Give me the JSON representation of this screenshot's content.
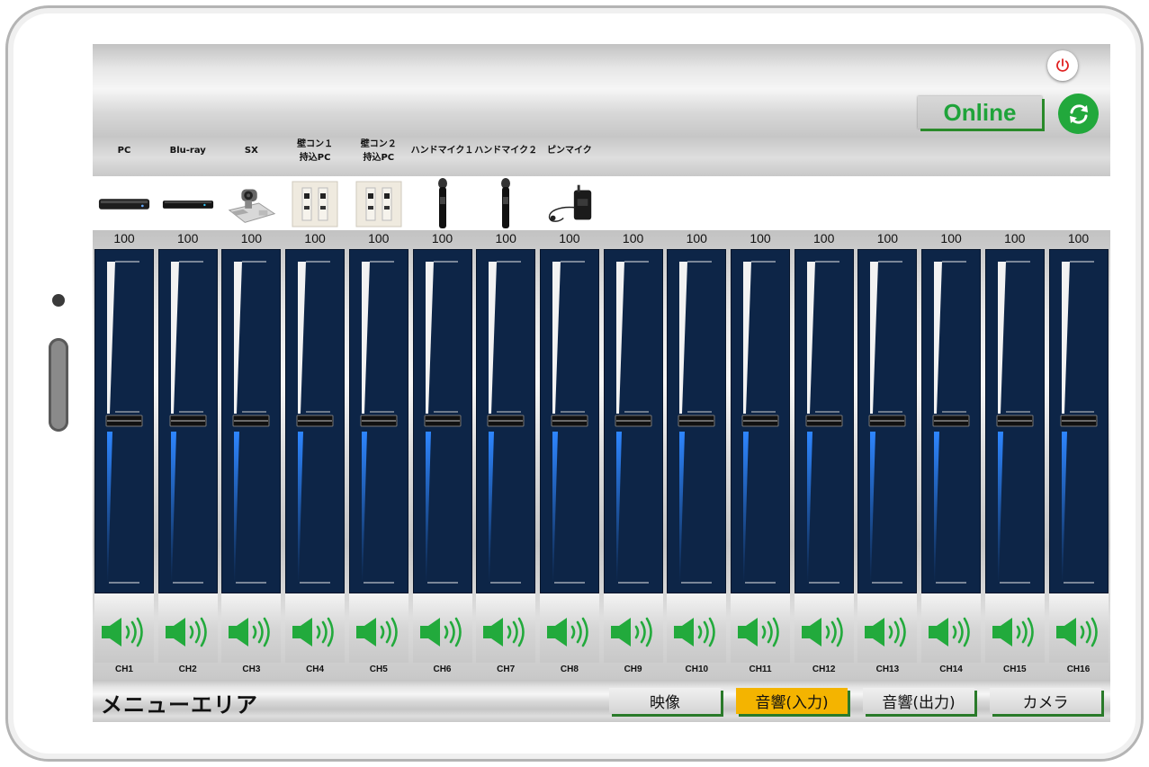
{
  "header": {
    "online_label": "Online",
    "power_icon": "power-icon",
    "refresh_icon": "refresh-icon"
  },
  "devices": [
    {
      "label_line1": "PC",
      "label_line2": "",
      "icon": "pc-icon"
    },
    {
      "label_line1": "Blu-ray",
      "label_line2": "",
      "icon": "bluray-player-icon"
    },
    {
      "label_line1": "SX",
      "label_line2": "",
      "icon": "conference-camera-icon"
    },
    {
      "label_line1": "壁コン１",
      "label_line2": "持込PC",
      "icon": "wall-panel-icon"
    },
    {
      "label_line1": "壁コン２",
      "label_line2": "持込PC",
      "icon": "wall-panel-icon"
    },
    {
      "label_line1": "ハンドマイク１",
      "label_line2": "",
      "icon": "handheld-mic-icon"
    },
    {
      "label_line1": "ハンドマイク２",
      "label_line2": "",
      "icon": "handheld-mic-icon"
    },
    {
      "label_line1": "ピンマイク",
      "label_line2": "",
      "icon": "pin-mic-icon"
    }
  ],
  "channels": [
    {
      "name": "CH1",
      "value": "100",
      "fader_level": 0.54,
      "muted": false
    },
    {
      "name": "CH2",
      "value": "100",
      "fader_level": 0.54,
      "muted": false
    },
    {
      "name": "CH3",
      "value": "100",
      "fader_level": 0.54,
      "muted": false
    },
    {
      "name": "CH4",
      "value": "100",
      "fader_level": 0.54,
      "muted": false
    },
    {
      "name": "CH5",
      "value": "100",
      "fader_level": 0.54,
      "muted": false
    },
    {
      "name": "CH6",
      "value": "100",
      "fader_level": 0.54,
      "muted": false
    },
    {
      "name": "CH7",
      "value": "100",
      "fader_level": 0.54,
      "muted": false
    },
    {
      "name": "CH8",
      "value": "100",
      "fader_level": 0.54,
      "muted": false
    },
    {
      "name": "CH9",
      "value": "100",
      "fader_level": 0.54,
      "muted": false
    },
    {
      "name": "CH10",
      "value": "100",
      "fader_level": 0.54,
      "muted": false
    },
    {
      "name": "CH11",
      "value": "100",
      "fader_level": 0.54,
      "muted": false
    },
    {
      "name": "CH12",
      "value": "100",
      "fader_level": 0.54,
      "muted": false
    },
    {
      "name": "CH13",
      "value": "100",
      "fader_level": 0.54,
      "muted": false
    },
    {
      "name": "CH14",
      "value": "100",
      "fader_level": 0.54,
      "muted": false
    },
    {
      "name": "CH15",
      "value": "100",
      "fader_level": 0.54,
      "muted": false
    },
    {
      "name": "CH16",
      "value": "100",
      "fader_level": 0.54,
      "muted": false
    }
  ],
  "speaker_icon": "speaker-on-icon",
  "footer": {
    "menu_title": "メニューエリア",
    "tabs": [
      {
        "label": "映像",
        "active": false
      },
      {
        "label": "音響(入力)",
        "active": true
      },
      {
        "label": "音響(出力)",
        "active": false
      },
      {
        "label": "カメラ",
        "active": false
      }
    ]
  },
  "colors": {
    "online_text": "#1fa33a",
    "refresh_bg": "#22a83c",
    "power_icon": "#e02020",
    "channel_panel": "#0d2547",
    "meter_blue": "#2e86ff",
    "speaker_green": "#22aa3c",
    "active_tab": "#f4b400"
  }
}
